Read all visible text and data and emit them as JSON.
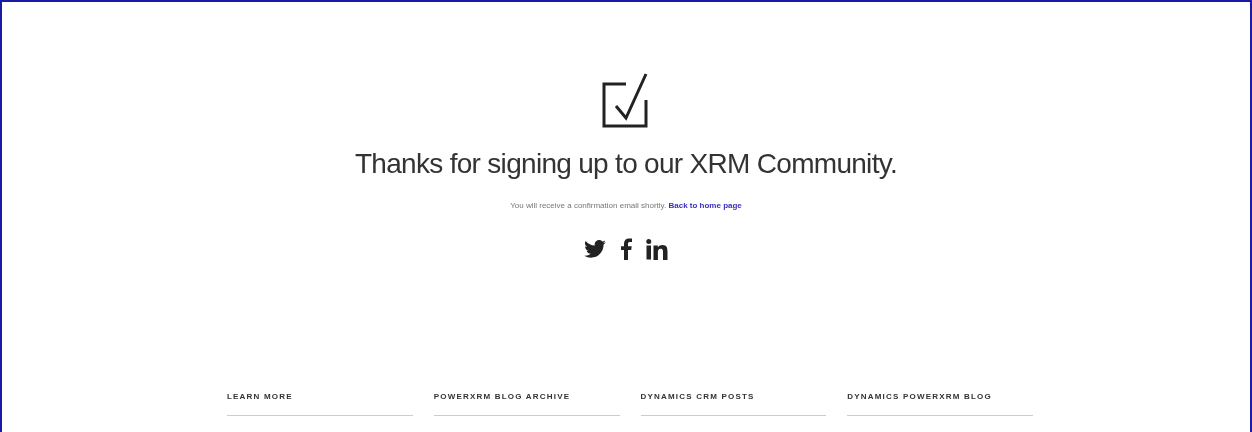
{
  "heading": "Thanks for signing up to our XRM Community.",
  "message": {
    "text": "You will receive a confirmation email shortly.",
    "link": "Back to home page"
  },
  "footer": {
    "columns": [
      {
        "title": "LEARN MORE"
      },
      {
        "title": "POWERXRM BLOG ARCHIVE"
      },
      {
        "title": "DYNAMICS CRM POSTS"
      },
      {
        "title": "DYNAMICS POWERXRM BLOG"
      }
    ]
  }
}
